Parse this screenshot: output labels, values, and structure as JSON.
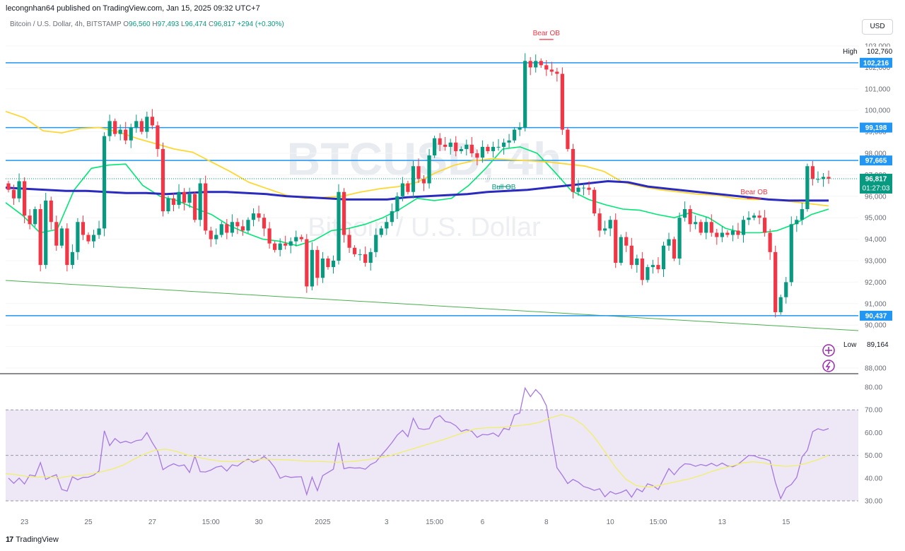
{
  "header": {
    "publisher": "lecongnhan64 published on TradingView.com, Jan 15, 2025 09:32 UTC+7",
    "symbol": "Bitcoin / U.S. Dollar, 4h, BITSTAMP",
    "open_label": "O",
    "open": "96,560",
    "high_label": "H",
    "high": "97,493",
    "low_label": "L",
    "low": "96,474",
    "close_label": "C",
    "close": "96,817",
    "change": "+294 (+0.30%)"
  },
  "currency": "USD",
  "watermark": {
    "ticker": "BTCUSD, 4h",
    "name": "Bitcoin / U.S. Dollar"
  },
  "footer": {
    "brand": "TradingView",
    "mark": "17"
  },
  "colors": {
    "up": "#089981",
    "down": "#f23645",
    "level_line": "#2196f3",
    "ema_fast": "#00e676",
    "ema_slow": "#fdd835",
    "ema_long": "#2a2abf",
    "rsi": "#a778de",
    "rsi_ma": "#f0f06a",
    "trend": "#4caf50",
    "rsi_band": "#ede7f6"
  },
  "price_tags": {
    "high_label": "High",
    "high_value": "102,760",
    "low_label": "Low",
    "low_value": "89,164",
    "current_price": "96,817",
    "countdown": "01:27:03"
  },
  "levels": [
    {
      "value": 102216,
      "label": "102,216"
    },
    {
      "value": 99198,
      "label": "99,198"
    },
    {
      "value": 97665,
      "label": "97,665"
    },
    {
      "value": 90437,
      "label": "90,437"
    }
  ],
  "annotations": [
    {
      "text": "Bear OB",
      "index": 101,
      "value": 103300
    },
    {
      "text": "Bull OB",
      "index": 93,
      "value": 96650
    },
    {
      "text": "Bear OB",
      "index": 140,
      "value": 95900
    }
  ],
  "icons": {
    "add": "plus-circle-icon",
    "alert": "lightning-circle-icon"
  },
  "chart_data": [
    {
      "type": "candlestick",
      "title": "Bitcoin / U.S. Dollar, 4h, BITSTAMP",
      "ylim": [
        88000,
        103000
      ],
      "y_ticks": [
        "88,000",
        "89,000",
        "90,000",
        "91,000",
        "92,000",
        "93,000",
        "94,000",
        "95,000",
        "96,000",
        "97,000",
        "98,000",
        "99,000",
        "100,000",
        "101,000",
        "102,000",
        "103,000"
      ],
      "x_ticks": [
        "23",
        "25",
        "27",
        "15:00",
        "30",
        "2025",
        "3",
        "15:00",
        "6",
        "8",
        "10",
        "15:00",
        "13",
        "15"
      ],
      "closes": [
        96300,
        95900,
        96700,
        95100,
        94700,
        95400,
        92800,
        95800,
        94800,
        93700,
        94500,
        92800,
        93400,
        94800,
        94200,
        93900,
        94200,
        94500,
        98800,
        99500,
        98900,
        99100,
        98600,
        99200,
        99500,
        99000,
        99700,
        99300,
        98200,
        95300,
        95900,
        95600,
        96200,
        95700,
        96100,
        94900,
        96600,
        94400,
        94000,
        94200,
        94700,
        94300,
        94800,
        94600,
        94400,
        94900,
        95200,
        95000,
        94500,
        93800,
        93500,
        93800,
        93700,
        93900,
        94100,
        94000,
        91800,
        93500,
        92200,
        93100,
        92700,
        93000,
        96200,
        94200,
        93600,
        93300,
        93300,
        92900,
        93400,
        94200,
        94500,
        94800,
        95300,
        96000,
        96600,
        96200,
        97400,
        96800,
        96600,
        97900,
        98700,
        98400,
        98300,
        98500,
        98100,
        98200,
        98400,
        98000,
        97800,
        98300,
        98100,
        98300,
        98300,
        98500,
        98600,
        99100,
        99200,
        102300,
        102000,
        102300,
        102100,
        101900,
        101800,
        101700,
        99100,
        98200,
        96200,
        96400,
        96400,
        96300,
        95200,
        94400,
        94500,
        94900,
        92900,
        94100,
        93700,
        92800,
        93100,
        92100,
        92700,
        92800,
        92600,
        93700,
        94000,
        93100,
        95000,
        95400,
        94700,
        94800,
        94300,
        94800,
        94300,
        94100,
        94300,
        94200,
        94400,
        94200,
        94900,
        95000,
        95100,
        95000,
        94300,
        93400,
        90600,
        91300,
        92000,
        94700,
        94900,
        95400,
        97400,
        96800,
        96800,
        96900,
        96817
      ],
      "series": [
        {
          "name": "EMA fast",
          "values": [
            95700,
            95100,
            94300,
            94450,
            96300,
            97300,
            97450,
            97500,
            96500,
            96000,
            95800,
            95450,
            95150,
            94650,
            94300,
            94000,
            93900,
            93700,
            93950,
            94400,
            94500,
            94700,
            95000,
            95400,
            95900,
            95800,
            95900,
            96500,
            97300,
            98200,
            98300,
            98000,
            97150,
            96250,
            95850,
            95600,
            95400,
            95350,
            95150,
            95000,
            95250,
            95000,
            94500,
            94300,
            94300,
            94400,
            94700,
            95150,
            95400
          ]
        },
        {
          "name": "EMA slow",
          "values": [
            99950,
            99650,
            99050,
            98950,
            99150,
            99200,
            99000,
            98700,
            98450,
            98200,
            98050,
            97600,
            97150,
            96650,
            96350,
            96050,
            95900,
            95950,
            96000,
            96200,
            96350,
            96450,
            96650,
            97100,
            97450,
            97650,
            97750,
            97700,
            97650,
            97600,
            97500,
            97400,
            97150,
            96650,
            96450,
            96300,
            96200,
            96100,
            96050,
            95900,
            95850,
            95850,
            95750,
            95650,
            95550
          ]
        },
        {
          "name": "EMA long",
          "values": [
            96400,
            96350,
            96300,
            96250,
            96250,
            96200,
            96150,
            96150,
            96100,
            96150,
            96200,
            96200,
            96150,
            96100,
            96000,
            95950,
            95900,
            95850,
            95850,
            95850,
            95950,
            96000,
            96050,
            96100,
            96200,
            96250,
            96300,
            96400,
            96500,
            96600,
            96700,
            96650,
            96450,
            96350,
            96250,
            96150,
            96050,
            95950,
            95850,
            95800,
            95800,
            95800
          ]
        }
      ]
    },
    {
      "type": "line",
      "title": "",
      "ylim": [
        28,
        82
      ],
      "y_ticks": [
        "30.00",
        "40.00",
        "50.00",
        "60.00",
        "70.00",
        "80.00"
      ],
      "bands": [
        30,
        50,
        70
      ],
      "series": [
        {
          "name": "RSI",
          "values": [
            40.0,
            37.7,
            40.0,
            37.4,
            41.4,
            40.9,
            46.8,
            39.4,
            40.6,
            41.5,
            35.0,
            34.3,
            40.6,
            39.3,
            40.3,
            40.4,
            41.3,
            43.1,
            60.8,
            54.3,
            57.4,
            55.5,
            56.2,
            55.4,
            56.5,
            56.8,
            60.0,
            55.6,
            51.9,
            43.7,
            45.2,
            46.3,
            45.3,
            45.8,
            42.5,
            49.7,
            42.8,
            42.7,
            43.5,
            44.8,
            45.3,
            43.1,
            45.8,
            45.3,
            47.1,
            48.4,
            46.9,
            48.0,
            49.5,
            47.6,
            44.6,
            39.9,
            40.9,
            40.3,
            40.5,
            40.6,
            32.8,
            40.4,
            34.5,
            41.1,
            42.5,
            43.9,
            55.6,
            44.1,
            44.7,
            44.4,
            44.5,
            43.9,
            46.0,
            47.1,
            50.1,
            52.7,
            55.6,
            58.9,
            61.0,
            58.2,
            66.3,
            61.8,
            61.4,
            61.7,
            66.2,
            67.5,
            64.9,
            64.4,
            63.0,
            60.5,
            61.3,
            60.6,
            57.9,
            59.2,
            59.0,
            59.8,
            58.3,
            61.9,
            61.2,
            67.8,
            68.6,
            79.6,
            75.8,
            78.9,
            76.5,
            71.8,
            57.9,
            44.5,
            41.2,
            37.6,
            39.4,
            38.2,
            36.3,
            35.6,
            34.6,
            35.3,
            31.8,
            34.1,
            33.0,
            33.7,
            34.8,
            31.6,
            35.3,
            34.0,
            37.5,
            36.7,
            35.0,
            39.6,
            44.2,
            41.5,
            44.4,
            46.3,
            46.1,
            45.2,
            46.0,
            45.4,
            46.5,
            45.3,
            46.6,
            45.3,
            45.0,
            46.1,
            48.0,
            50.0,
            49.8,
            48.9,
            48.4,
            47.6,
            38.1,
            31.0,
            35.7,
            37.2,
            40.3,
            49.3,
            52.2,
            60.4,
            61.7,
            61.0,
            61.8
          ]
        },
        {
          "name": "RSI MA",
          "values": [
            42.0,
            41.5,
            40.7,
            40.4,
            40.6,
            40.1,
            40.9,
            41.2,
            41.8,
            42.8,
            44.0,
            45.7,
            48.3,
            50.6,
            52.3,
            52.7,
            51.7,
            50.2,
            49.2,
            48.2,
            47.5,
            47.2,
            47.5,
            47.9,
            48.4,
            48.2,
            48.1,
            47.8,
            47.5,
            47.4,
            47.2,
            47.0,
            47.2,
            47.6,
            48.2,
            49.0,
            49.9,
            51.3,
            52.7,
            54.2,
            55.6,
            57.0,
            58.6,
            60.2,
            61.7,
            62.1,
            62.2,
            62.6,
            63.1,
            63.6,
            64.6,
            66.5,
            67.9,
            66.6,
            63.5,
            58.5,
            52.1,
            45.1,
            39.6,
            36.7,
            36.0,
            36.6,
            37.7,
            38.7,
            39.7,
            41.1,
            42.8,
            44.2,
            45.4,
            46.7,
            47.2,
            46.6,
            45.6,
            45.2,
            45.5,
            46.6,
            48.1,
            50.0
          ]
        }
      ]
    }
  ]
}
